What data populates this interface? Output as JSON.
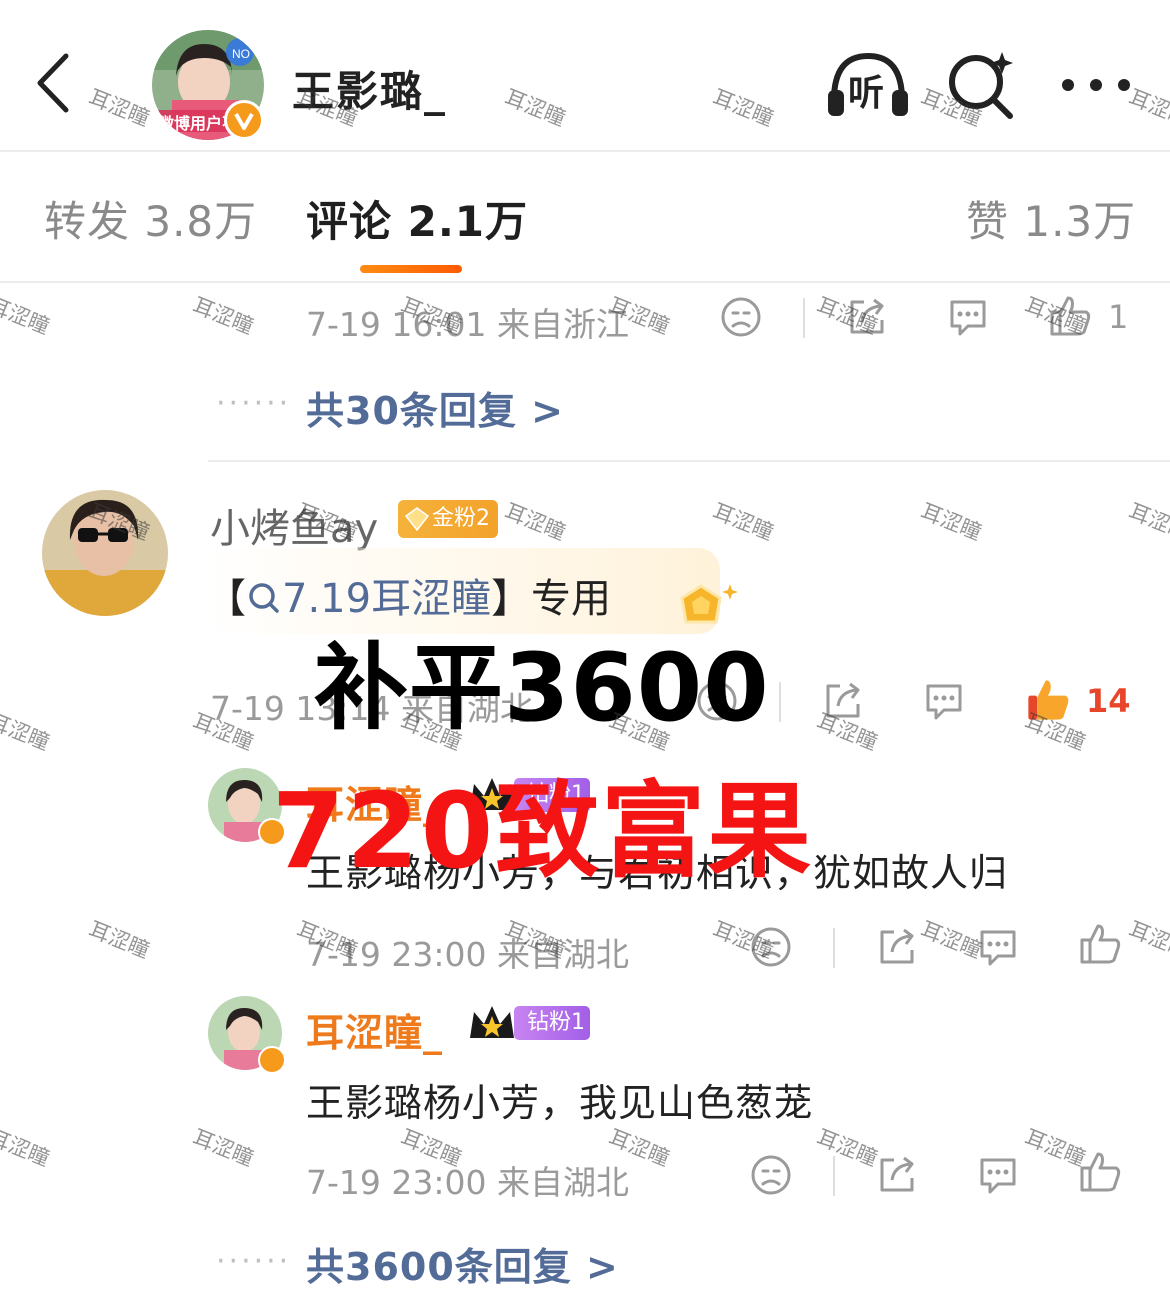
{
  "header": {
    "title": "王影璐_",
    "avatar_badge_text": "微博用户不",
    "listen_label": "听"
  },
  "tabs": [
    {
      "label": "转发 3.8万",
      "active": false
    },
    {
      "label": "评论 2.1万",
      "active": true
    },
    {
      "label": "赞 1.3万",
      "active": false
    }
  ],
  "comment1": {
    "meta": "7-19 16:01 来自浙江",
    "likes": "1",
    "more_replies": "共30条回复 >"
  },
  "comment2": {
    "name": "小烤鱼ay",
    "fan_badge": "金粉2",
    "text_prefix": "【",
    "topic": "7.19耳涩瞳",
    "text_suffix": "】专用",
    "meta": "7-19 13:14 来自湖北",
    "likes": "14"
  },
  "overlay": {
    "black_text": "补平3600",
    "red_text": "720致富果"
  },
  "replies": [
    {
      "name": "耳涩瞳_",
      "badge": "钻粉1",
      "text": "王影璐杨小芳，与君初相识，犹如故人归",
      "meta": "7-19 23:00 来自湖北"
    },
    {
      "name": "耳涩瞳_",
      "badge": "钻粉1",
      "text": "王影璐杨小芳，我见山色葱茏",
      "meta": "7-19 23:00 来自湖北"
    }
  ],
  "replies_more": "共3600条回复 >",
  "watermark": "耳涩瞳",
  "colors": {
    "accent_orange": "#ff7a00",
    "link_blue": "#536b97",
    "overlay_red": "#f41414",
    "meta_gray": "#9a9a9a"
  },
  "icons": [
    "back-icon",
    "listen-icon",
    "search-icon",
    "more-icon",
    "sad-face-icon",
    "share-icon",
    "comment-icon",
    "thumb-up-icon",
    "crown-icon",
    "gem-icon"
  ]
}
